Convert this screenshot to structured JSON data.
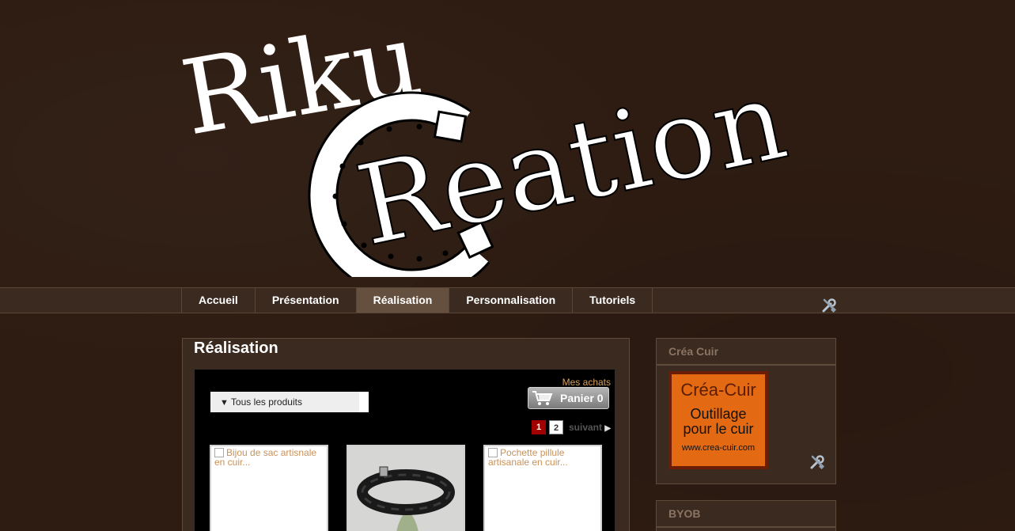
{
  "logo": {
    "line1": "Riku",
    "line2": "Reation"
  },
  "nav": {
    "items": [
      {
        "label": "Accueil",
        "active": false
      },
      {
        "label": "Présentation",
        "active": false
      },
      {
        "label": "Réalisation",
        "active": true
      },
      {
        "label": "Personnalisation",
        "active": false
      },
      {
        "label": "Tutoriels",
        "active": false
      }
    ],
    "tools_icon": "tools-icon"
  },
  "main": {
    "title": "Réalisation",
    "shop": {
      "category_select": "Tous les produits",
      "mes_achats": "Mes achats",
      "cart_label": "Panier 0",
      "pagination": {
        "current": "1",
        "other": "2",
        "next": "suivant"
      },
      "products": [
        {
          "alt": "Bijou de sac artisnale en cuir..."
        },
        {
          "alt": ""
        },
        {
          "alt": "Pochette pillule artisanale en cuir..."
        }
      ]
    }
  },
  "sidebar": {
    "crea": {
      "title": "Créa Cuir",
      "ad": {
        "brand": "Créa-Cuir",
        "line2": "Outillage",
        "line3": "pour le cuir",
        "url": "www.crea-cuir.com"
      }
    },
    "byob": {
      "title": "BYOB"
    }
  },
  "colors": {
    "background": "#2e1c12",
    "nav_bg": "#3b2a20",
    "nav_active": "#65503f",
    "link": "#d7a05f",
    "ad_orange": "#e36a12",
    "pagination_current": "#a00000"
  }
}
